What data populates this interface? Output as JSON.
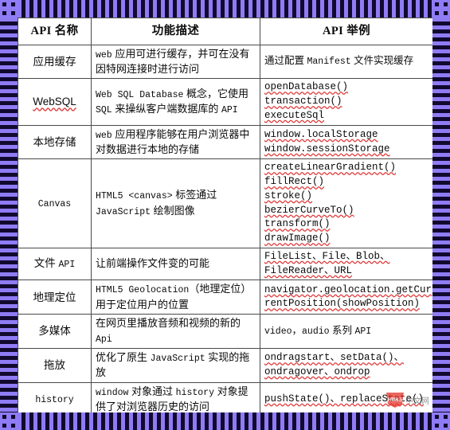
{
  "frame": {
    "stripe_purple": "#8f7cf5",
    "stripe_dark": "#120a2e"
  },
  "table": {
    "headers": [
      "API 名称",
      "功能描述",
      "API 举例"
    ],
    "rows": [
      {
        "name": "应用缓存",
        "desc_html": "<span class=\"mono\">web</span> 应用可进行缓存，并可在没有因特网连接时进行访问",
        "desc_text": "web 应用可进行缓存，并可在没有因特网连接时进行访问",
        "examples": [
          "通过配置 Manifest 文件实现缓存"
        ],
        "examples_cjk": true
      },
      {
        "name": "WebSQL",
        "name_squiggle": true,
        "desc_text": "Web SQL Database 概念，它使用 SQL 来操纵客户端数据库的 API",
        "examples": [
          "openDatabase()",
          "transaction()",
          "executeSql"
        ]
      },
      {
        "name": "本地存储",
        "desc_text": "web 应用程序能够在用户浏览器中对数据进行本地的存储",
        "examples": [
          "window.localStorage",
          "window.sessionStorage"
        ]
      },
      {
        "name": "Canvas",
        "desc_text": "HTML5 <canvas> 标签通过 JavaScript 绘制图像",
        "examples": [
          "createLinearGradient()",
          "fillRect()",
          "stroke()",
          "bezierCurveTo()",
          "transform()",
          "drawImage()"
        ]
      },
      {
        "name": "文件 API",
        "desc_text": "让前端操作文件变的可能",
        "examples": [
          "FileList、File、Blob、",
          "FileReader、URL"
        ]
      },
      {
        "name": "地理定位",
        "desc_text": "HTML5 Geolocation（地理定位）用于定位用户的位置",
        "examples": [
          "navigator.geolocation.getCur",
          "rentPosition(showPosition)"
        ]
      },
      {
        "name": "多媒体",
        "desc_text": "在网页里播放音频和视频的新的 Api",
        "examples": [
          "video，audio 系列 API"
        ],
        "examples_cjk": true
      },
      {
        "name": "拖放",
        "desc_text": "优化了原生 JavaScript 实现的拖放",
        "examples": [
          "ondragstart、setData()、",
          "ondragover、ondrop"
        ]
      },
      {
        "name": "history",
        "desc_text": "window 对象通过 history 对象提供了对浏览器历史的访问",
        "examples": [
          "pushState()、replaceState()"
        ]
      }
    ]
  },
  "watermark": {
    "logo_label": "HTML5",
    "text": "中文网"
  }
}
